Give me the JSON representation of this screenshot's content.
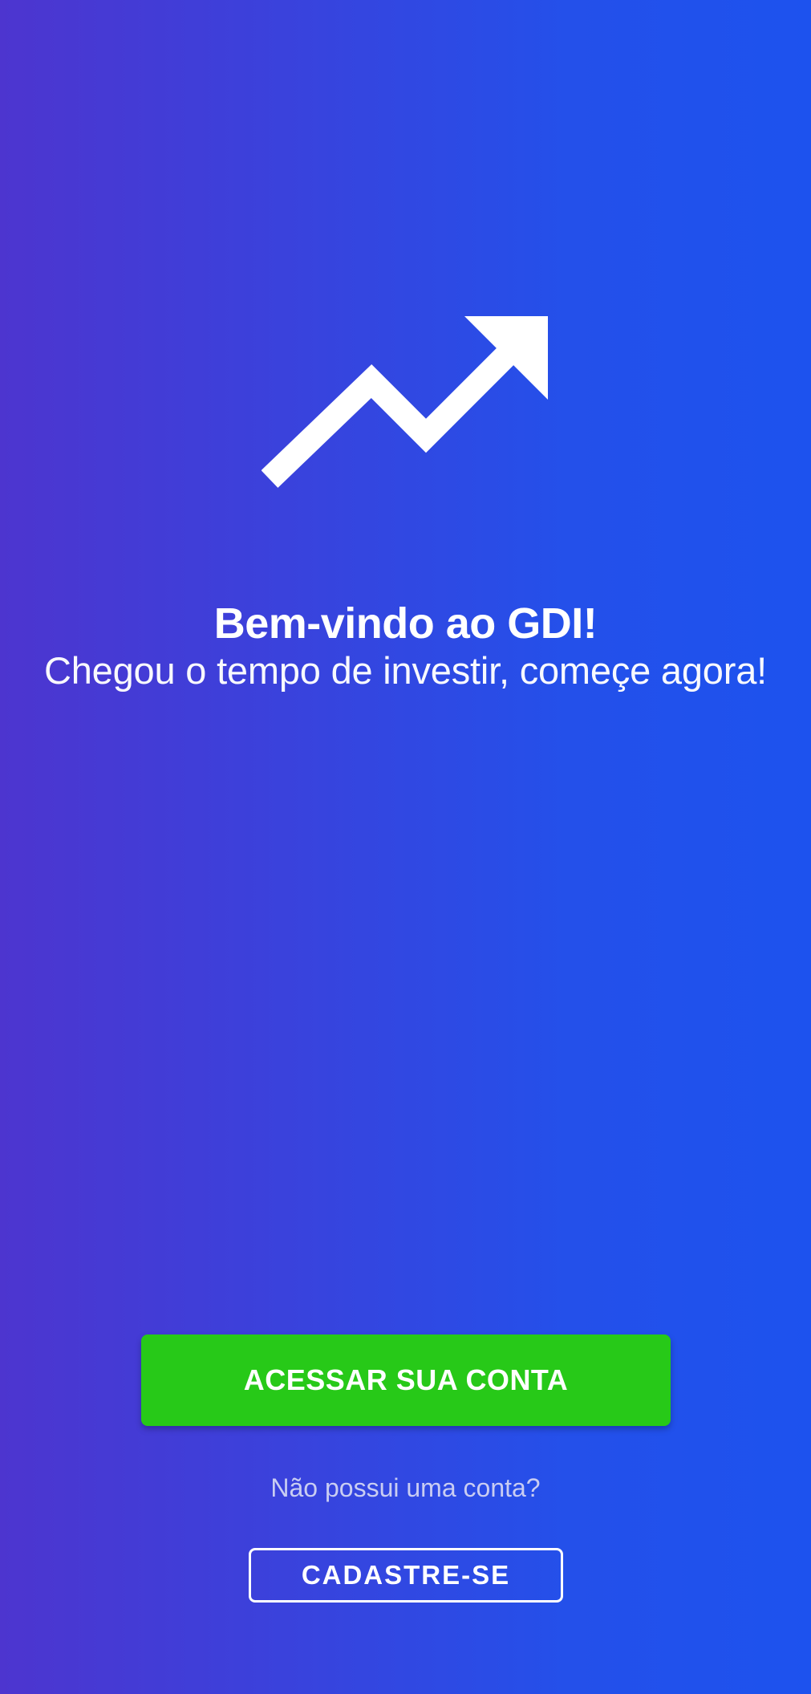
{
  "welcome": {
    "icon": "trending-up-arrow-icon",
    "title": "Bem-vindo ao GDI!",
    "subtitle": "Chegou o tempo de investir, começe agora!"
  },
  "actions": {
    "login_label": "ACESSAR SUA CONTA",
    "no_account_text": "Não possui uma conta?",
    "signup_label": "CADASTRE-SE"
  },
  "colors": {
    "gradient_start": "#4d35cf",
    "gradient_end": "#1d52ee",
    "login_button": "#27c918",
    "signup_border": "#ffffff"
  }
}
